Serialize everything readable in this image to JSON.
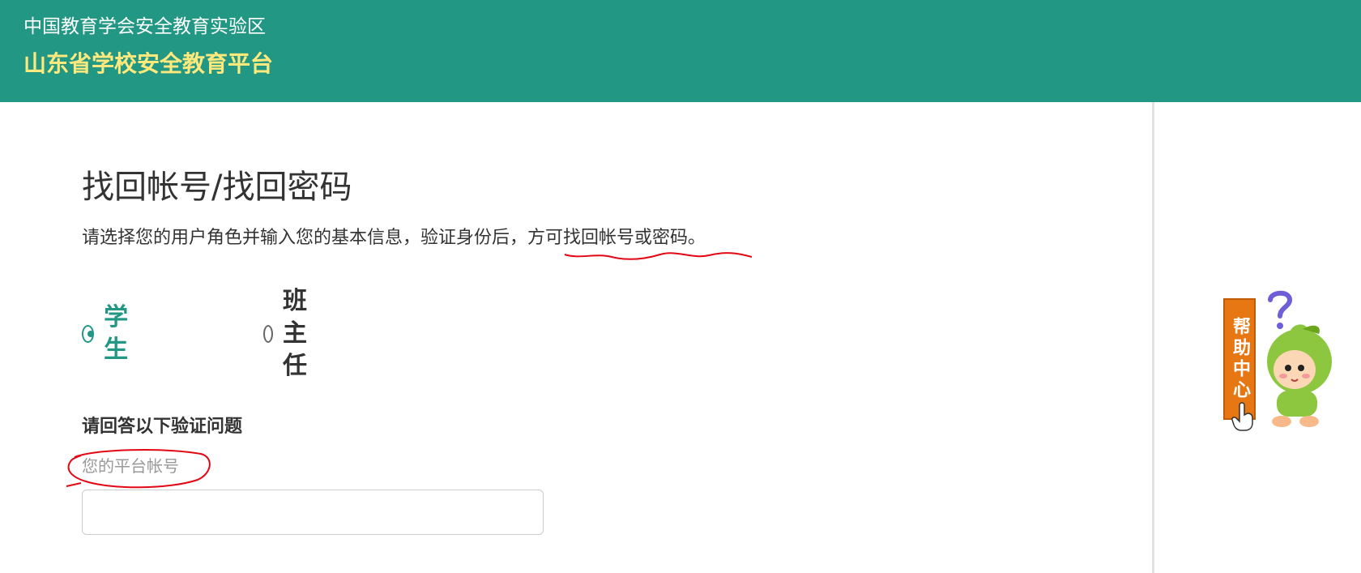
{
  "header": {
    "org_name": "中国教育学会安全教育实验区",
    "platform_name": "山东省学校安全教育平台"
  },
  "page": {
    "title": "找回帐号/找回密码",
    "description": "请选择您的用户角色并输入您的基本信息，验证身份后，方可找回帐号或密码。"
  },
  "roles": {
    "selected": "学生",
    "options": [
      {
        "label": "学生",
        "checked": true
      },
      {
        "label": "班主任",
        "checked": false
      }
    ]
  },
  "verification": {
    "title": "请回答以下验证问题",
    "account_label": "您的平台帐号",
    "account_value": ""
  },
  "help": {
    "label": "帮助中心",
    "icon": "question-mark-icon",
    "mascot": "cartoon-child-mascot",
    "cursor": "hand-pointer-icon"
  },
  "colors": {
    "header_bg": "#219784",
    "platform_title": "#ffe97d",
    "accent": "#219784",
    "help_tag": "#e67713",
    "annotation": "#e30613"
  }
}
